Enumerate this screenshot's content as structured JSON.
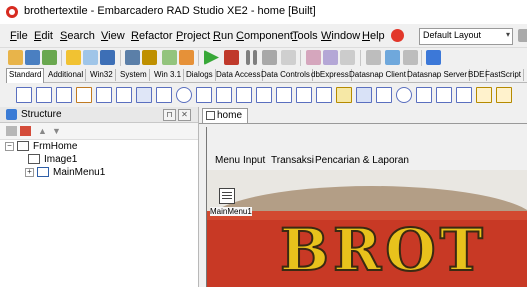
{
  "window": {
    "title": "brothertextile - Embarcadero RAD Studio XE2 - home [Built]"
  },
  "menubar": {
    "items": [
      "File",
      "Edit",
      "Search",
      "View",
      "Refactor",
      "Project",
      "Run",
      "Component",
      "Tools",
      "Window",
      "Help"
    ],
    "layout_select": "Default Layout"
  },
  "palette": {
    "tabs": [
      "Standard",
      "Additional",
      "Win32",
      "System",
      "Win 3.1",
      "Dialogs",
      "Data Access",
      "Data Controls",
      "dbExpress",
      "Datasnap Client",
      "Datasnap Server",
      "BDE",
      "FastScript"
    ],
    "active_tab": "Standard"
  },
  "structure": {
    "title": "Structure",
    "tree": [
      {
        "label": "FrmHome",
        "expander": "−"
      },
      {
        "label": "Image1"
      },
      {
        "label": "MainMenu1",
        "expander": "+"
      }
    ]
  },
  "editor": {
    "tab_label": "home",
    "form_menu": [
      "Menu",
      "Input",
      "Transaksi",
      "Pencarian & Laporan"
    ],
    "component_label": "MainMenu1",
    "banner_text": "BROT"
  },
  "icons": {
    "app": "delphi-icon",
    "help": "help-icon",
    "structure": "structure-icon"
  }
}
